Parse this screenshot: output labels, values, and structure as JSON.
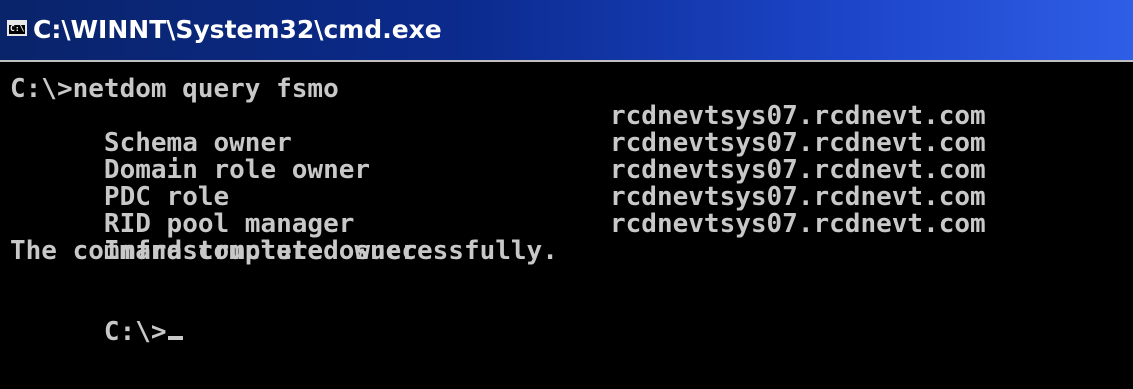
{
  "window": {
    "title": "C:\\WINNT\\System32\\cmd.exe",
    "title_icon": "cmd-window-icon",
    "title_icon_glyph": "C:\\"
  },
  "console": {
    "command_line": "C:\\>netdom query fsmo",
    "roles": [
      {
        "role": "Schema owner",
        "owner": "rcdnevtsys07.rcdnevt.com"
      },
      {
        "role": "Domain role owner",
        "owner": "rcdnevtsys07.rcdnevt.com"
      },
      {
        "role": "PDC role",
        "owner": "rcdnevtsys07.rcdnevt.com"
      },
      {
        "role": "RID pool manager",
        "owner": "rcdnevtsys07.rcdnevt.com"
      },
      {
        "role": "Infrastructure owner",
        "owner": "rcdnevtsys07.rcdnevt.com"
      }
    ],
    "status": "The command completed successfully.",
    "prompt": "C:\\>"
  },
  "colors": {
    "console_bg": "#000000",
    "console_text": "#c8c8c8",
    "titlebar_start": "#0a246a",
    "titlebar_end": "#2f5ee6"
  }
}
